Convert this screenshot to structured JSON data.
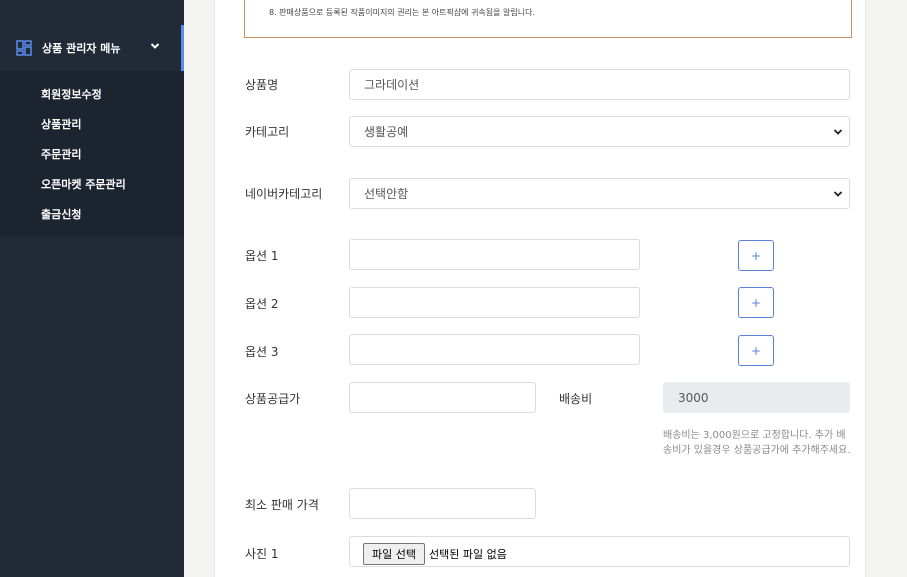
{
  "sidebar": {
    "menu_title": "상품 관리자 메뉴",
    "items": [
      {
        "label": "회원정보수정"
      },
      {
        "label": "상품관리"
      },
      {
        "label": "주문관리"
      },
      {
        "label": "오픈마켓 주문관리"
      },
      {
        "label": "출금신청"
      }
    ]
  },
  "notice": {
    "text": "8. 판매상품으로 등록된 작품이미지의 권리는 본 아트픽샵에 귀속됨을 알립니다."
  },
  "form": {
    "product_name": {
      "label": "상품명",
      "value": "그라데이션"
    },
    "category": {
      "label": "카테고리",
      "value": "생활공예"
    },
    "naver_category": {
      "label": "네이버카테고리",
      "value": "선택안함"
    },
    "options": [
      {
        "label": "옵션 1",
        "value": "",
        "add_label": "+"
      },
      {
        "label": "옵션 2",
        "value": "",
        "add_label": "+"
      },
      {
        "label": "옵션 3",
        "value": "",
        "add_label": "+"
      }
    ],
    "supply_price": {
      "label": "상품공급가",
      "value": ""
    },
    "shipping": {
      "label": "배송비",
      "value": "3000"
    },
    "shipping_help": "배송비는 3,000원으로 고정합니다. 추가 배송비가 있을경우 상품공급가에 추가해주세요.",
    "min_price": {
      "label": "최소 판매 가격",
      "value": ""
    },
    "photo1": {
      "label": "사진 1",
      "button": "파일 선택",
      "status": "선택된 파일 없음"
    }
  },
  "colors": {
    "sidebar_bg": "#212a37",
    "accent": "#5b8def",
    "notice_border": "#c98e5a"
  }
}
